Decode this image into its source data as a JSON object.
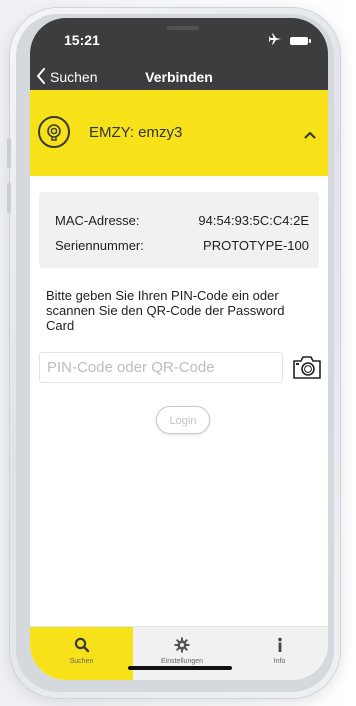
{
  "status_bar": {
    "time": "15:21"
  },
  "nav": {
    "back_label": "Suchen",
    "title": "Verbinden"
  },
  "device": {
    "name": "EMZY: emzy3"
  },
  "info": {
    "mac_label": "MAC-Adresse:",
    "mac_value": "94:54:93:5C:C4:2E",
    "serial_label": "Seriennummer:",
    "serial_value": "PROTOTYPE-100"
  },
  "instruction": "Bitte geben Sie Ihren PIN-Code ein oder scannen Sie den QR-Code der Password Card",
  "pin_input": {
    "placeholder": "PIN-Code oder QR-Code",
    "value": ""
  },
  "login_label": "Login",
  "tabs": [
    {
      "label": "Suchen",
      "icon": "search-icon",
      "active": true
    },
    {
      "label": "Einstellungen",
      "icon": "gear-icon",
      "active": false
    },
    {
      "label": "Info",
      "icon": "info-icon",
      "active": false
    }
  ],
  "colors": {
    "accent": "#f7e119",
    "header": "#3d3d3f"
  }
}
